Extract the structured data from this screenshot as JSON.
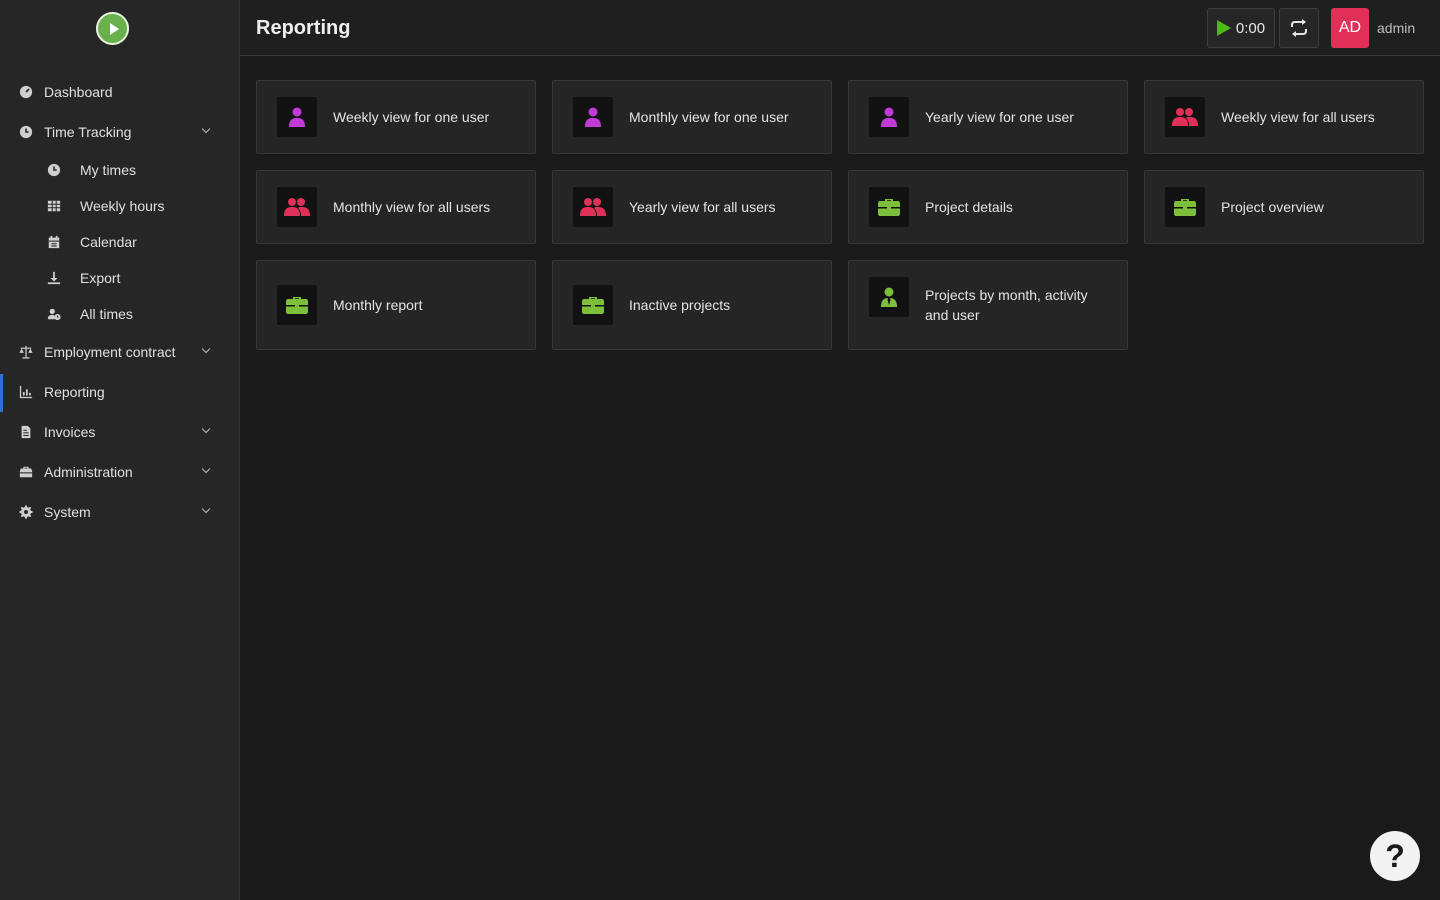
{
  "header": {
    "title": "Reporting",
    "timer": "0:00",
    "avatar_initials": "AD",
    "username": "admin"
  },
  "sidebar": {
    "items": [
      {
        "label": "Dashboard",
        "icon": "gauge-icon"
      },
      {
        "label": "Time Tracking",
        "icon": "clock-icon",
        "expanded": true,
        "children": [
          {
            "label": "My times",
            "icon": "clock-icon"
          },
          {
            "label": "Weekly hours",
            "icon": "table-icon"
          },
          {
            "label": "Calendar",
            "icon": "calendar-icon"
          },
          {
            "label": "Export",
            "icon": "download-icon"
          },
          {
            "label": "All times",
            "icon": "user-clock-icon"
          }
        ]
      },
      {
        "label": "Employment contract",
        "icon": "balance-scale-icon"
      },
      {
        "label": "Reporting",
        "icon": "chart-icon",
        "active": true
      },
      {
        "label": "Invoices",
        "icon": "invoice-icon"
      },
      {
        "label": "Administration",
        "icon": "toolbox-icon"
      },
      {
        "label": "System",
        "icon": "gear-icon"
      }
    ]
  },
  "reports": [
    {
      "label": "Weekly view for one user",
      "icon": "user-icon",
      "color": "#c13bd9"
    },
    {
      "label": "Monthly view for one user",
      "icon": "user-icon",
      "color": "#c13bd9"
    },
    {
      "label": "Yearly view for one user",
      "icon": "user-icon",
      "color": "#c13bd9"
    },
    {
      "label": "Weekly view for all users",
      "icon": "users-icon",
      "color": "#e0305a"
    },
    {
      "label": "Monthly view for all users",
      "icon": "users-icon",
      "color": "#e0305a"
    },
    {
      "label": "Yearly view for all users",
      "icon": "users-icon",
      "color": "#e0305a"
    },
    {
      "label": "Project details",
      "icon": "briefcase-icon",
      "color": "#7bbf3a"
    },
    {
      "label": "Project overview",
      "icon": "briefcase-icon",
      "color": "#7bbf3a"
    },
    {
      "label": "Monthly report",
      "icon": "briefcase-icon",
      "color": "#7bbf3a"
    },
    {
      "label": "Inactive projects",
      "icon": "briefcase-icon",
      "color": "#7bbf3a"
    },
    {
      "label": "Projects by month, activity and user",
      "icon": "user-tie-icon",
      "color": "#7bbf3a"
    }
  ],
  "help": {
    "label": "?"
  }
}
